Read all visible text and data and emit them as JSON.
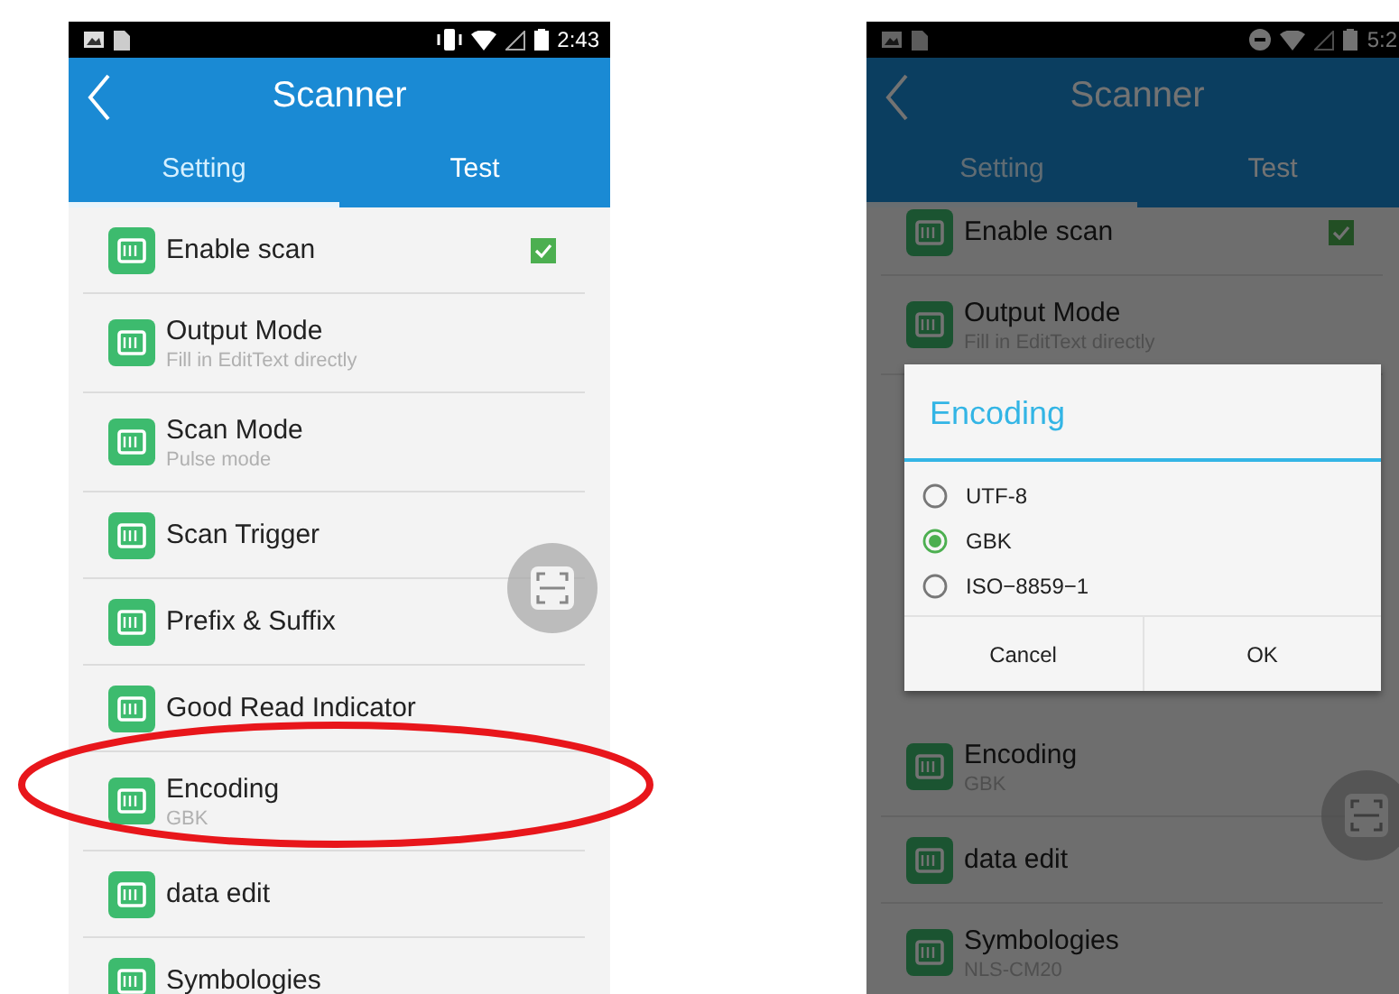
{
  "screens": [
    {
      "status_bar": {
        "time": "2:43"
      },
      "title": "Scanner",
      "tabs": [
        {
          "label": "Setting",
          "selected": true
        },
        {
          "label": "Test",
          "selected": false
        }
      ],
      "settings": [
        {
          "title": "Enable scan",
          "checked": true
        },
        {
          "title": "Output Mode",
          "subtitle": "Fill in EditText directly"
        },
        {
          "title": "Scan Mode",
          "subtitle": "Pulse mode"
        },
        {
          "title": "Scan Trigger"
        },
        {
          "title": "Prefix & Suffix"
        },
        {
          "title": "Good Read Indicator"
        },
        {
          "title": "Encoding",
          "subtitle": "GBK"
        },
        {
          "title": "data edit"
        },
        {
          "title": "Symbologies"
        }
      ]
    },
    {
      "status_bar": {
        "time": "5:2"
      },
      "title": "Scanner",
      "tabs": [
        {
          "label": "Setting",
          "selected": true
        },
        {
          "label": "Test",
          "selected": false
        }
      ],
      "settings": [
        {
          "title": "Enable scan",
          "checked": true
        },
        {
          "title": "Output Mode",
          "subtitle": "Fill in EditText directly"
        }
      ],
      "settings_below_dialog": [
        {
          "title": "Encoding",
          "subtitle": "GBK"
        },
        {
          "title": "data edit"
        },
        {
          "title": "Symbologies",
          "subtitle": "NLS-CM20"
        }
      ],
      "dialog": {
        "title": "Encoding",
        "options": [
          {
            "label": "UTF-8",
            "selected": false
          },
          {
            "label": "GBK",
            "selected": true
          },
          {
            "label": "ISO−8859−1",
            "selected": false
          }
        ],
        "buttons": [
          "Cancel",
          "OK"
        ]
      }
    }
  ]
}
